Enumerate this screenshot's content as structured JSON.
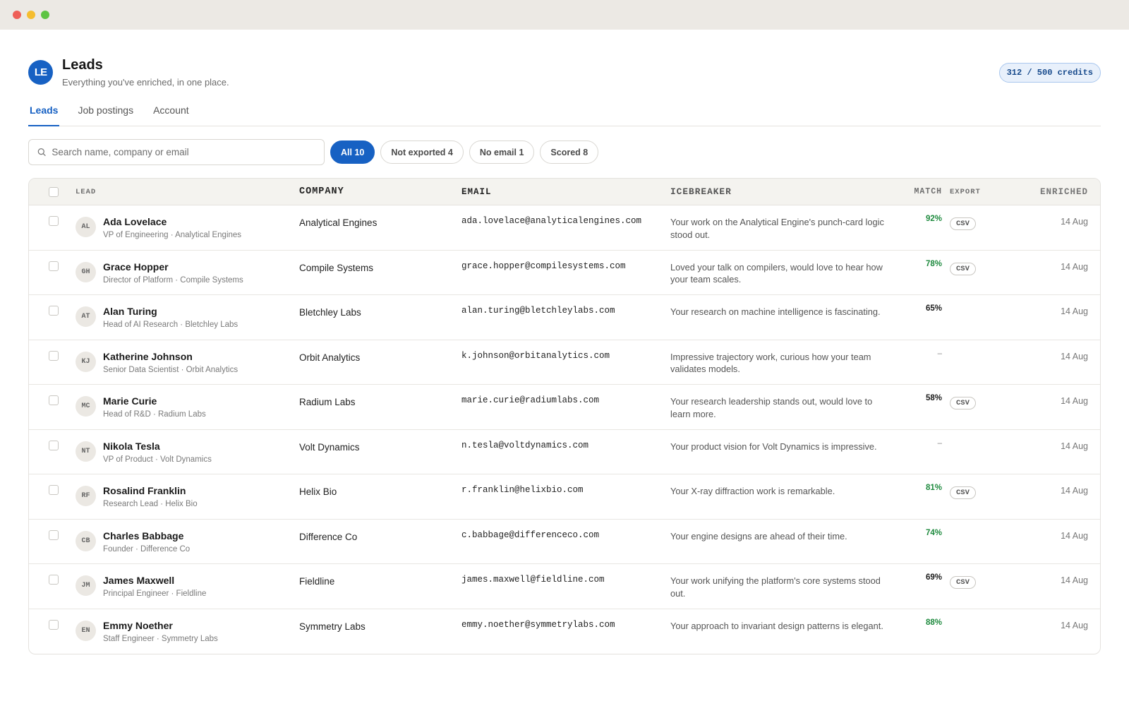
{
  "app": {
    "logo_text": "LE",
    "title": "Leads",
    "subtitle": "Everything you've enriched, in one place.",
    "credits": "312 / 500 credits"
  },
  "colors": {
    "accent": "#1761c3",
    "match_green": "#1e8a3e",
    "titlebar": "#ece9e4"
  },
  "tabs": [
    {
      "label": "Leads",
      "active": true
    },
    {
      "label": "Job postings",
      "active": false
    },
    {
      "label": "Account",
      "active": false
    }
  ],
  "search": {
    "placeholder": "Search name, company or email",
    "icon": "search-icon"
  },
  "filters": [
    {
      "label": "All 10",
      "active": true
    },
    {
      "label": "Not exported 4",
      "active": false
    },
    {
      "label": "No email 1",
      "active": false
    },
    {
      "label": "Scored 8",
      "active": false
    }
  ],
  "table": {
    "headers": {
      "lead": "LEAD",
      "company": "COMPANY",
      "email": "EMAIL",
      "icebreaker": "ICEBREAKER",
      "match": "MATCH",
      "export": "EXPORT",
      "enriched": "ENRICHED"
    },
    "rows": [
      {
        "initials": "AL",
        "name": "Ada Lovelace",
        "role": "VP of Engineering · Analytical Engines",
        "company": "Analytical Engines",
        "email": "ada.lovelace@analyticalengines.com",
        "icebreaker": "Your work on the Analytical Engine's punch-card logic stood out.",
        "match": "92%",
        "match_style": "green",
        "export": "CSV",
        "enriched": "14 Aug"
      },
      {
        "initials": "GH",
        "name": "Grace Hopper",
        "role": "Director of Platform · Compile Systems",
        "company": "Compile Systems",
        "email": "grace.hopper@compilesystems.com",
        "icebreaker": "Loved your talk on compilers, would love to hear how your team scales.",
        "match": "78%",
        "match_style": "green",
        "export": "CSV",
        "enriched": "14 Aug"
      },
      {
        "initials": "AT",
        "name": "Alan Turing",
        "role": "Head of AI Research · Bletchley Labs",
        "company": "Bletchley Labs",
        "email": "alan.turing@bletchleylabs.com",
        "icebreaker": "Your research on machine intelligence is fascinating.",
        "match": "65%",
        "match_style": "black",
        "export": "",
        "enriched": "14 Aug"
      },
      {
        "initials": "KJ",
        "name": "Katherine Johnson",
        "role": "Senior Data Scientist · Orbit Analytics",
        "company": "Orbit Analytics",
        "email": "k.johnson@orbitanalytics.com",
        "icebreaker": "Impressive trajectory work, curious how your team validates models.",
        "match": "–",
        "match_style": "dash",
        "export": "",
        "enriched": "14 Aug"
      },
      {
        "initials": "MC",
        "name": "Marie Curie",
        "role": "Head of R&D · Radium Labs",
        "company": "Radium Labs",
        "email": "marie.curie@radiumlabs.com",
        "icebreaker": "Your research leadership stands out, would love to learn more.",
        "match": "58%",
        "match_style": "black",
        "export": "CSV",
        "enriched": "14 Aug"
      },
      {
        "initials": "NT",
        "name": "Nikola Tesla",
        "role": "VP of Product · Volt Dynamics",
        "company": "Volt Dynamics",
        "email": "n.tesla@voltdynamics.com",
        "icebreaker": "Your product vision for Volt Dynamics is impressive.",
        "match": "–",
        "match_style": "dash",
        "export": "",
        "enriched": "14 Aug"
      },
      {
        "initials": "RF",
        "name": "Rosalind Franklin",
        "role": "Research Lead · Helix Bio",
        "company": "Helix Bio",
        "email": "r.franklin@helixbio.com",
        "icebreaker": "Your X-ray diffraction work is remarkable.",
        "match": "81%",
        "match_style": "green",
        "export": "CSV",
        "enriched": "14 Aug"
      },
      {
        "initials": "CB",
        "name": "Charles Babbage",
        "role": "Founder · Difference Co",
        "company": "Difference Co",
        "email": "c.babbage@differenceco.com",
        "icebreaker": "Your engine designs are ahead of their time.",
        "match": "74%",
        "match_style": "green",
        "export": "",
        "enriched": "14 Aug"
      },
      {
        "initials": "JM",
        "name": "James Maxwell",
        "role": "Principal Engineer · Fieldline",
        "company": "Fieldline",
        "email": "james.maxwell@fieldline.com",
        "icebreaker": "Your work unifying the platform's core systems stood out.",
        "match": "69%",
        "match_style": "black",
        "export": "CSV",
        "enriched": "14 Aug"
      },
      {
        "initials": "EN",
        "name": "Emmy Noether",
        "role": "Staff Engineer · Symmetry Labs",
        "company": "Symmetry Labs",
        "email": "emmy.noether@symmetrylabs.com",
        "icebreaker": "Your approach to invariant design patterns is elegant.",
        "match": "88%",
        "match_style": "green",
        "export": "",
        "enriched": "14 Aug"
      }
    ]
  }
}
